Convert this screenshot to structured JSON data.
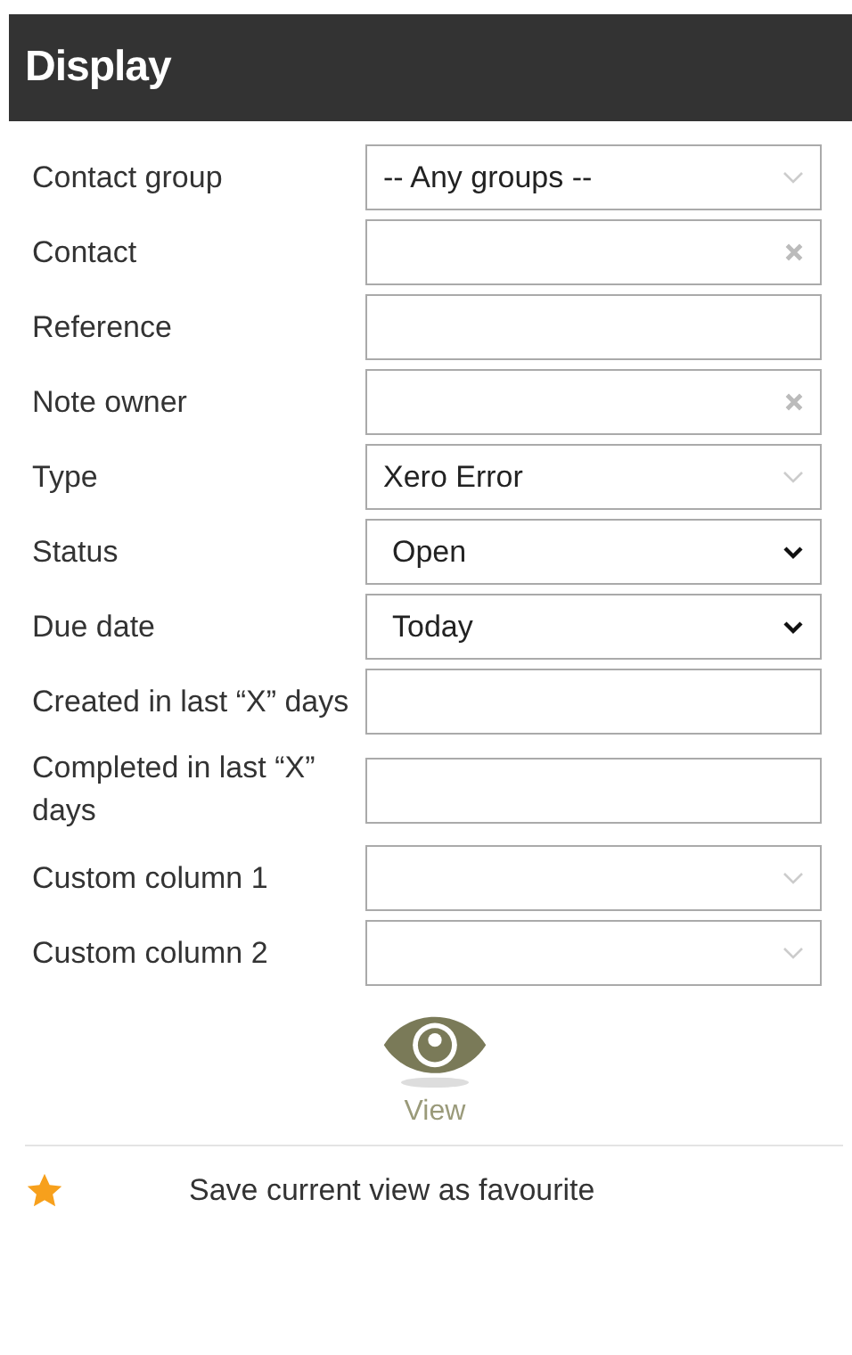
{
  "header": {
    "title": "Display"
  },
  "fields": [
    {
      "label": "Contact group",
      "kind": "combo",
      "value": "-- Any groups --"
    },
    {
      "label": "Contact",
      "kind": "clearable"
    },
    {
      "label": "Reference",
      "kind": "text"
    },
    {
      "label": "Note owner",
      "kind": "clearable"
    },
    {
      "label": "Type",
      "kind": "combo",
      "value": "Xero Error"
    },
    {
      "label": "Status",
      "kind": "select",
      "value": "Open"
    },
    {
      "label": "Due date",
      "kind": "select",
      "value": "Today"
    },
    {
      "label": "Created in last “X” days",
      "kind": "text"
    },
    {
      "label": "Completed in last “X” days",
      "kind": "text"
    },
    {
      "label": "Custom column 1",
      "kind": "combo"
    },
    {
      "label": "Custom column 2",
      "kind": "combo"
    }
  ],
  "view_button": {
    "label": "View"
  },
  "favourite": {
    "label": "Save current view as favourite"
  }
}
